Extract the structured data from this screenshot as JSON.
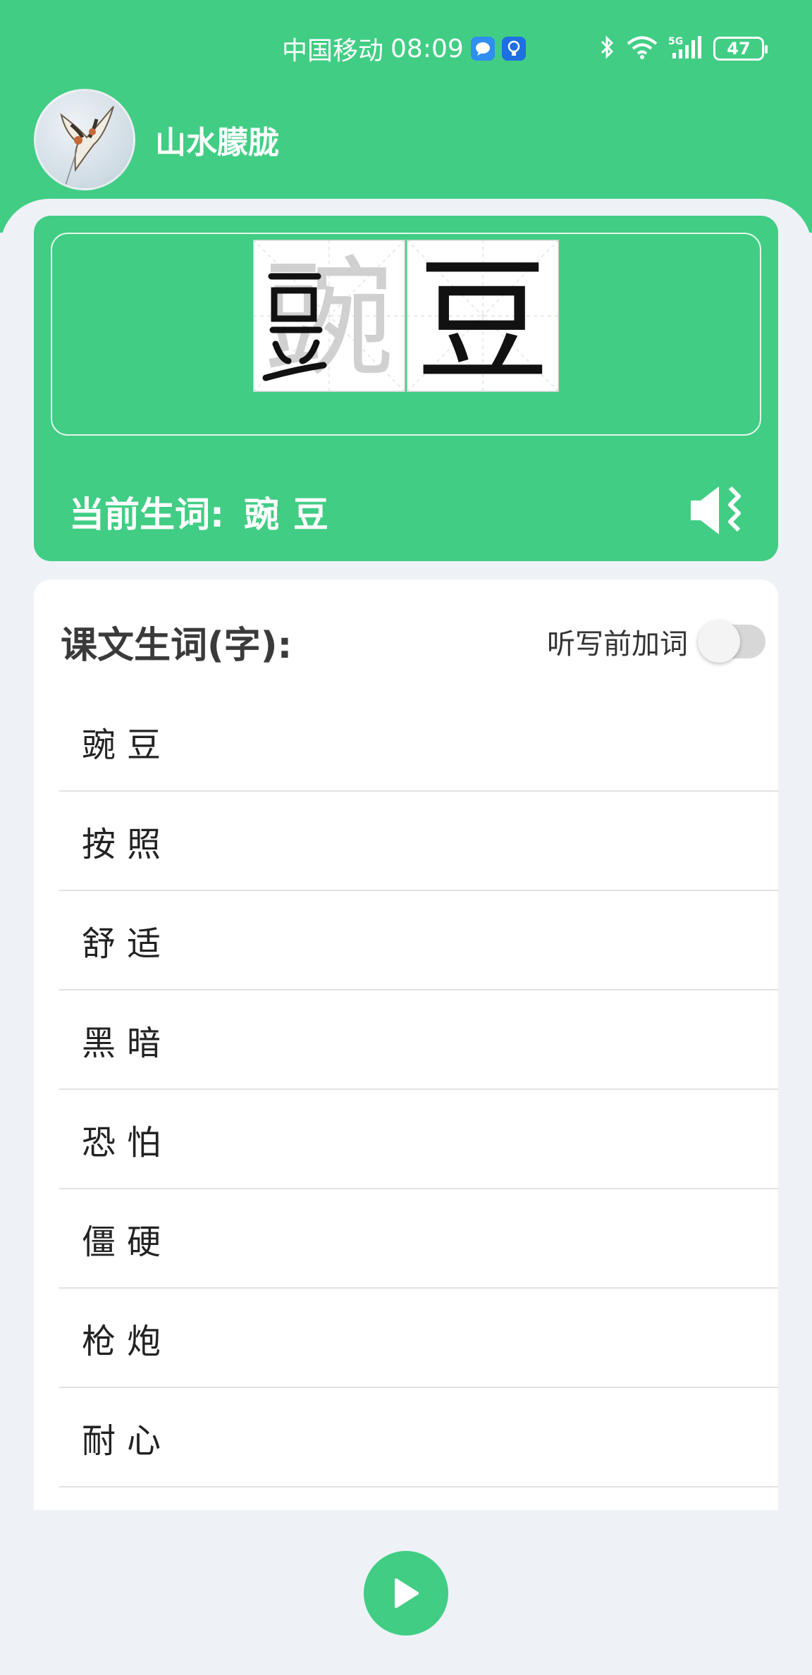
{
  "status_bar": {
    "carrier": "中国移动",
    "time": "08:09",
    "battery": "47"
  },
  "profile": {
    "name": "山水朦胧"
  },
  "word_card": {
    "chars": [
      "豌",
      "豆"
    ],
    "current_label": "当前生词:",
    "current_word": "豌豆"
  },
  "list": {
    "title": "课文生词(字):",
    "toggle_label": "听写前加词",
    "toggle_on": false,
    "words": [
      "豌豆",
      "按照",
      "舒适",
      "黑暗",
      "恐怕",
      "僵硬",
      "枪炮",
      "耐心"
    ]
  },
  "colors": {
    "accent": "#41cd84",
    "background": "#eef2f7"
  }
}
